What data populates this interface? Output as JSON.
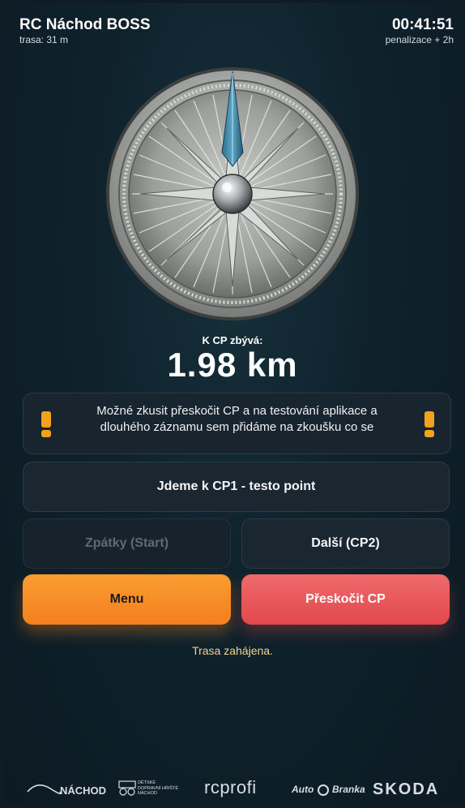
{
  "header": {
    "title": "RC Náchod BOSS",
    "route": "trasa: 31 m",
    "timer": "00:41:51",
    "penalty": "penalizace + 2h"
  },
  "compass": {
    "icon": "compass-icon"
  },
  "distance": {
    "label": "K CP zbývá:",
    "value": "1.98 km"
  },
  "notice": {
    "text": "Možné zkusit přeskočit CP a na testování aplikace a dlouhého záznamu sem přidáme na zkoušku co se",
    "icon": "warning-icon",
    "color": "#f2a21c"
  },
  "checkpoint": {
    "label": "Jdeme k CP1 - testo point"
  },
  "nav": {
    "back_label": "Zpátky (Start)",
    "next_label": "Další (CP2)"
  },
  "actions": {
    "menu_label": "Menu",
    "skip_label": "Přeskočit CP",
    "menu_color": "#f7902a",
    "skip_color": "#e8585b"
  },
  "status": "Trasa zahájena.",
  "sponsors": {
    "nachod": "NÁCHOD",
    "playground": [
      "DĚTSKÉ",
      "DOPRAVNÍ HŘIŠTĚ",
      "NÁCHOD"
    ],
    "rcprofi": "rcprofi",
    "autobranka": [
      "Auto",
      "Branka"
    ],
    "skoda": "SKODA"
  }
}
